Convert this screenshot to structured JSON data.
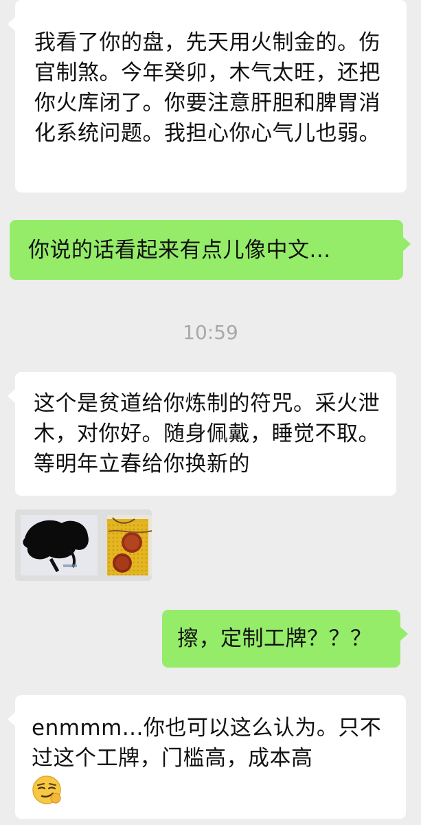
{
  "messages": [
    {
      "direction": "incoming",
      "text": "我看了你的盘，先天用火制金的。伤官制煞。今年癸卯，木气太旺，还把你火库闭了。你要注意肝胆和脾胃消化系统问题。我担心你心气儿也弱。"
    },
    {
      "direction": "outgoing",
      "text": "你说的话看起来有点儿像中文..."
    },
    {
      "direction": "incoming",
      "text": "这个是贫道给你炼制的符咒。采火泄木，对你好。随身佩戴，睡觉不取。等明年立春给你换新的"
    },
    {
      "direction": "outgoing",
      "text": "擦，定制工牌？？？"
    },
    {
      "direction": "incoming",
      "text": "enmmm...你也可以这么认为。只不过这个工牌，门槛高，成本高",
      "emoji": "smirking-face-emoji"
    }
  ],
  "timestamp": "10:59",
  "colors": {
    "background": "#ededed",
    "incoming_bubble": "#ffffff",
    "outgoing_bubble": "#95ec69",
    "timestamp_text": "#a8a8a8"
  }
}
